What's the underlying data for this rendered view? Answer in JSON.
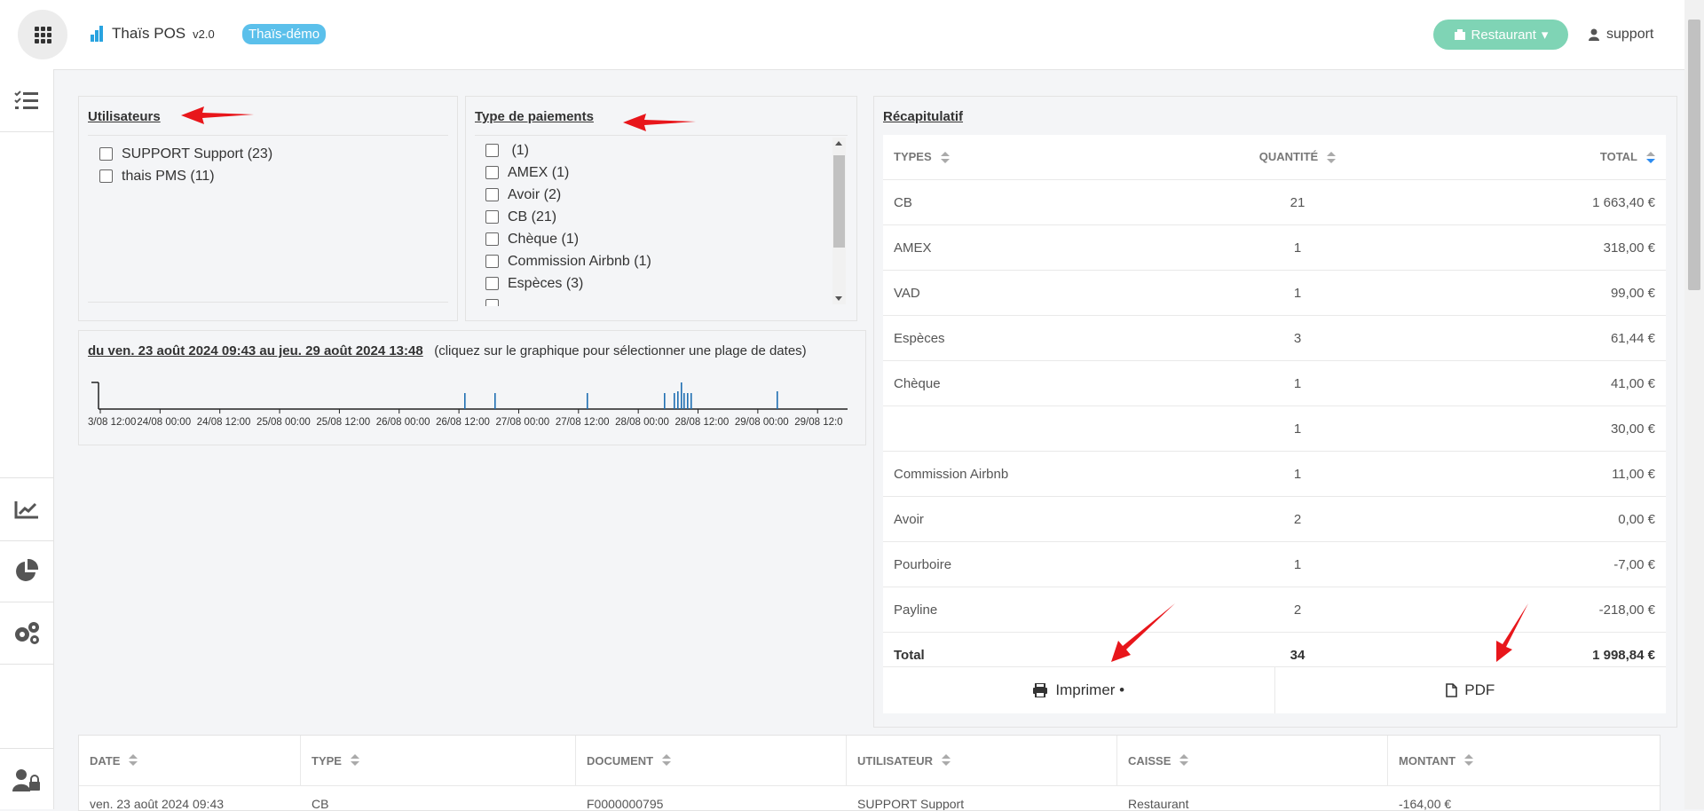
{
  "header": {
    "app_name": "Thaïs POS",
    "version": "v2.0",
    "demo_badge": "Thaïs-démo",
    "restaurant_button": "Restaurant",
    "user": "support"
  },
  "users_panel": {
    "title": "Utilisateurs",
    "items": [
      "SUPPORT Support (23)",
      "thais PMS (11)"
    ]
  },
  "payments_panel": {
    "title": "Type de paiements",
    "items": [
      " (1)",
      "AMEX (1)",
      "Avoir (2)",
      "CB (21)",
      "Chèque (1)",
      "Commission Airbnb (1)",
      "Espèces (3)"
    ]
  },
  "timeline": {
    "range": "du ven. 23 août 2024 09:43 au jeu. 29 août 2024 13:48",
    "hint": "(cliquez sur le graphique pour sélectionner une plage de dates)",
    "ticks": [
      "3/08 12:00",
      "24/08 00:00",
      "24/08 12:00",
      "25/08 00:00",
      "25/08 12:00",
      "26/08 00:00",
      "26/08 12:00",
      "27/08 00:00",
      "27/08 12:00",
      "28/08 00:00",
      "28/08 12:00",
      "29/08 00:00",
      "29/08 12:0"
    ]
  },
  "recap": {
    "title": "Récapitulatif",
    "headers": {
      "types": "TYPES",
      "quantity": "QUANTITÉ",
      "total": "TOTAL"
    },
    "rows": [
      {
        "type": "CB",
        "qty": "21",
        "total": "1 663,40 €"
      },
      {
        "type": "AMEX",
        "qty": "1",
        "total": "318,00 €"
      },
      {
        "type": "VAD",
        "qty": "1",
        "total": "99,00 €"
      },
      {
        "type": "Espèces",
        "qty": "3",
        "total": "61,44 €"
      },
      {
        "type": "Chèque",
        "qty": "1",
        "total": "41,00 €"
      },
      {
        "type": "",
        "qty": "1",
        "total": "30,00 €"
      },
      {
        "type": "Commission Airbnb",
        "qty": "1",
        "total": "11,00 €"
      },
      {
        "type": "Avoir",
        "qty": "2",
        "total": "0,00 €"
      },
      {
        "type": "Pourboire",
        "qty": "1",
        "total": "-7,00 €"
      },
      {
        "type": "Payline",
        "qty": "2",
        "total": "-218,00 €"
      }
    ],
    "total_row": {
      "label": "Total",
      "qty": "34",
      "total": "1 998,84 €"
    },
    "print_button": "Imprimer •",
    "pdf_button": "PDF"
  },
  "transactions": {
    "headers": [
      "DATE",
      "TYPE",
      "DOCUMENT",
      "UTILISATEUR",
      "CAISSE",
      "MONTANT"
    ],
    "first_row": [
      "ven. 23 août 2024 09:43",
      "CB",
      "F0000000795",
      "SUPPORT Support",
      "Restaurant",
      "-164,00 €"
    ]
  },
  "colors": {
    "accent_green": "#7fd4b5",
    "badge_blue": "#5bc0eb",
    "chart_bar": "#1f6fb2",
    "annotation_arrow": "#e8161b"
  }
}
